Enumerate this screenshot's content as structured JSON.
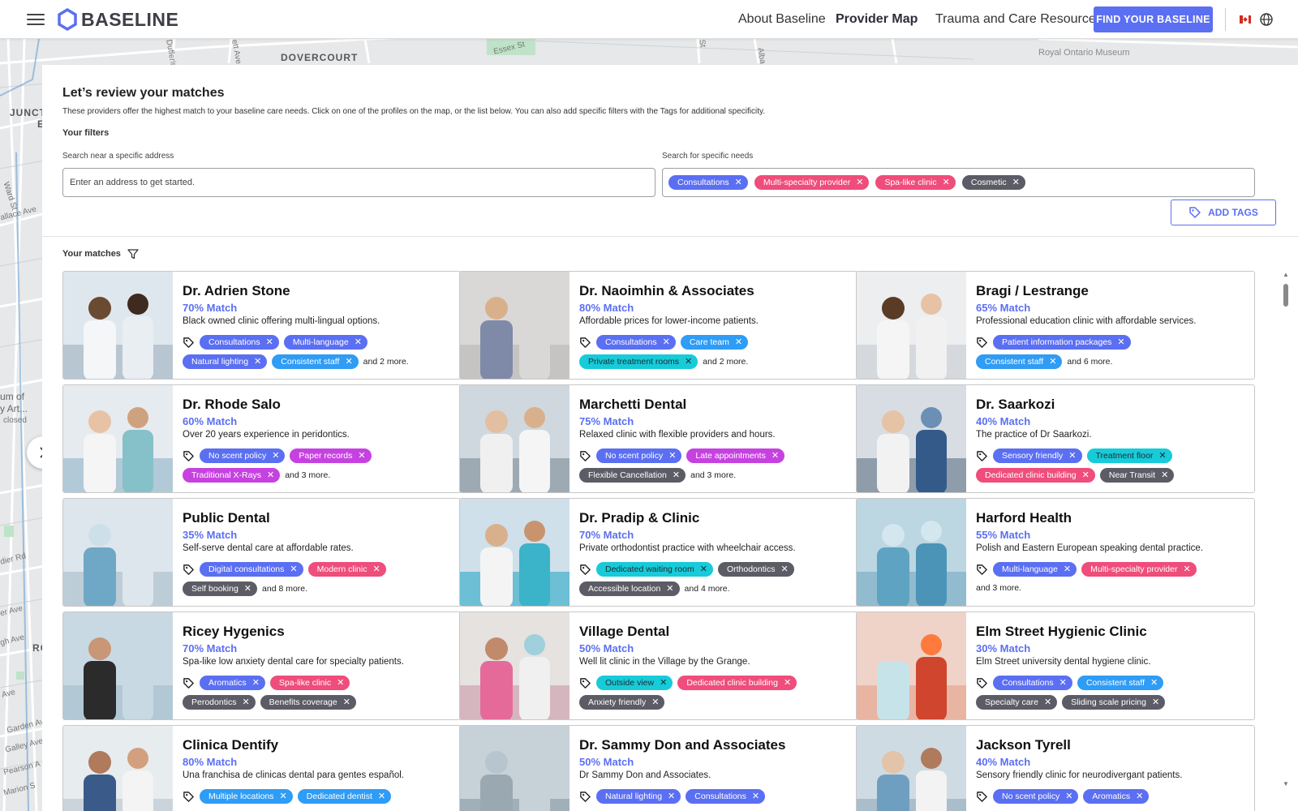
{
  "header": {
    "logo_text": "BASELINE",
    "nav": {
      "about": "About Baseline",
      "provider_map": "Provider Map",
      "resources": "Trauma and Care Resources"
    },
    "cta": "FIND YOUR BASELINE"
  },
  "map": {
    "labels": [
      "DOVERCOURT",
      "JUNCT",
      "E",
      "Ward St",
      "allace Ave",
      "um of",
      "y Art...",
      "closed",
      "dier Rd",
      "er Ave",
      "gh Ave",
      "RO",
      "Ave",
      "Garden Av",
      "Galley Ave",
      "Pearson A",
      "Marion S",
      "Dufferin",
      "ett Ave",
      "Essex St",
      "St",
      "Alba",
      "Royal Ontario Museum"
    ]
  },
  "panel": {
    "title": "Let’s review your matches",
    "description": "These providers offer the highest match to your baseline care needs. Click on one of the profiles on the map, or the list below. You can also add specific filters with the Tags for additional specificity.",
    "filters_label": "Your filters",
    "address_label": "Search near a specific address",
    "address_placeholder": "Enter an address to get started.",
    "needs_label": "Search for specific needs",
    "needs_tags": [
      {
        "label": "Consultations",
        "color": "#5b6ff2"
      },
      {
        "label": "Multi-specialty provider",
        "color": "#ef4d7b"
      },
      {
        "label": "Spa-like clinic",
        "color": "#ef4d7b"
      },
      {
        "label": "Cosmetic",
        "color": "#5c5c66"
      }
    ],
    "add_tags_label": "ADD TAGS",
    "matches_label": "Your matches"
  },
  "providers": [
    {
      "name": "Dr. Adrien Stone",
      "match": "70% Match",
      "desc": "Black owned clinic offering multi-lingual options.",
      "row1": [
        {
          "label": "Consultations",
          "c": "indigo"
        },
        {
          "label": "Multi-language",
          "c": "indigo"
        }
      ],
      "row2": [
        {
          "label": "Natural lighting",
          "c": "indigo"
        },
        {
          "label": "Consistent staff",
          "c": "blue"
        }
      ],
      "more": "and 2 more."
    },
    {
      "name": "Dr. Naoimhin & Associates",
      "match": "80% Match",
      "desc": "Affordable prices for lower-income patients.",
      "row1": [
        {
          "label": "Consultations",
          "c": "indigo"
        },
        {
          "label": "Care team",
          "c": "blue"
        }
      ],
      "row2": [
        {
          "label": "Private treatment rooms",
          "c": "cyan"
        }
      ],
      "more": "and 2 more."
    },
    {
      "name": "Bragi / Lestrange",
      "match": "65% Match",
      "desc": "Professional education clinic with affordable services.",
      "row1": [
        {
          "label": "Patient information packages",
          "c": "indigo"
        }
      ],
      "row2": [
        {
          "label": "Consistent staff",
          "c": "blue"
        }
      ],
      "more": "and 6 more."
    },
    {
      "name": "Dr. Rhode Salo",
      "match": "60% Match",
      "desc": "Over 20 years experience in peridontics.",
      "row1": [
        {
          "label": "No scent policy",
          "c": "indigo"
        },
        {
          "label": "Paper records",
          "c": "purple"
        }
      ],
      "row2": [
        {
          "label": "Traditional X-Rays",
          "c": "purple"
        }
      ],
      "more": "and 3 more."
    },
    {
      "name": "Marchetti Dental",
      "match": "75% Match",
      "desc": "Relaxed clinic with flexible providers and hours.",
      "row1": [
        {
          "label": "No scent policy",
          "c": "indigo"
        },
        {
          "label": "Late appointments",
          "c": "purple"
        }
      ],
      "row2": [
        {
          "label": "Flexible Cancellation",
          "c": "gray"
        }
      ],
      "more": "and 3 more."
    },
    {
      "name": "Dr. Saarkozi",
      "match": "40% Match",
      "desc": "The practice of Dr Saarkozi.",
      "row1": [
        {
          "label": "Sensory friendly",
          "c": "indigo"
        },
        {
          "label": "Treatment floor",
          "c": "cyan"
        }
      ],
      "row2": [
        {
          "label": "Dedicated clinic building",
          "c": "pink"
        },
        {
          "label": "Near Transit",
          "c": "gray"
        }
      ],
      "more": ""
    },
    {
      "name": "Public Dental",
      "match": "35% Match",
      "desc": "Self-serve dental care at affordable rates.",
      "row1": [
        {
          "label": "Digital consultations",
          "c": "indigo"
        },
        {
          "label": "Modern clinic",
          "c": "pink"
        }
      ],
      "row2": [
        {
          "label": "Self booking",
          "c": "gray"
        }
      ],
      "more": "and 8 more."
    },
    {
      "name": "Dr. Pradip & Clinic",
      "match": "70% Match",
      "desc": "Private orthodontist practice with wheelchair access.",
      "row1": [
        {
          "label": "Dedicated waiting room",
          "c": "cyan"
        },
        {
          "label": "Orthodontics",
          "c": "gray"
        }
      ],
      "row2": [
        {
          "label": "Accessible location",
          "c": "gray"
        }
      ],
      "more": "and 4 more."
    },
    {
      "name": "Harford Health",
      "match": "55% Match",
      "desc": "Polish and Eastern European speaking dental practice.",
      "row1": [
        {
          "label": "Multi-language",
          "c": "indigo"
        },
        {
          "label": "Multi-specialty provider",
          "c": "pink"
        }
      ],
      "row2": [],
      "more": "and 3 more."
    },
    {
      "name": "Ricey Hygenics",
      "match": "70% Match",
      "desc": "Spa-like low anxiety dental care for specialty patients.",
      "row1": [
        {
          "label": "Aromatics",
          "c": "indigo"
        },
        {
          "label": "Spa-like clinic",
          "c": "pink"
        }
      ],
      "row2": [
        {
          "label": "Perodontics",
          "c": "gray"
        },
        {
          "label": "Benefits coverage",
          "c": "gray"
        }
      ],
      "more": ""
    },
    {
      "name": "Village Dental",
      "match": "50% Match",
      "desc": "Well lit clinic in the Village by the Grange.",
      "row1": [
        {
          "label": "Outside view",
          "c": "cyan"
        },
        {
          "label": "Dedicated clinic building",
          "c": "pink"
        }
      ],
      "row2": [
        {
          "label": "Anxiety friendly",
          "c": "gray"
        }
      ],
      "more": ""
    },
    {
      "name": "Elm Street Hygienic Clinic",
      "match": "30% Match",
      "desc": "Elm Street university dental hygiene clinic.",
      "row1": [
        {
          "label": "Consultations",
          "c": "indigo"
        },
        {
          "label": "Consistent staff",
          "c": "blue"
        }
      ],
      "row2": [
        {
          "label": "Specialty care",
          "c": "gray"
        },
        {
          "label": "Sliding scale pricing",
          "c": "gray"
        }
      ],
      "more": ""
    },
    {
      "name": "Clinica Dentify",
      "match": "80% Match",
      "desc": "Una franchisa de clinicas dental para gentes español.",
      "row1": [
        {
          "label": "Multiple locations",
          "c": "blue"
        },
        {
          "label": "Dedicated dentist",
          "c": "blue"
        }
      ],
      "row2": [],
      "more": ""
    },
    {
      "name": "Dr. Sammy Don and Associates",
      "match": "50% Match",
      "desc": "Dr Sammy Don and Associates.",
      "row1": [
        {
          "label": "Natural lighting",
          "c": "indigo"
        },
        {
          "label": "Consultations",
          "c": "indigo"
        }
      ],
      "row2": [],
      "more": ""
    },
    {
      "name": "Jackson Tyrell",
      "match": "40% Match",
      "desc": "Sensory friendly clinic for neurodivergant patients.",
      "row1": [
        {
          "label": "No scent policy",
          "c": "indigo"
        },
        {
          "label": "Aromatics",
          "c": "indigo"
        }
      ],
      "row2": [],
      "more": ""
    }
  ],
  "icons": {
    "menu": "hamburger-icon",
    "logo": "hexagon-logo-icon",
    "flag": "canada-flag-icon",
    "globe": "globe-icon",
    "tag": "tag-icon",
    "filter": "filter-icon",
    "close": "close-icon",
    "chevron": "chevron-right-icon"
  },
  "colors": {
    "accent": "#5b6ff2",
    "pink": "#ef4d7b",
    "purple": "#c642e0",
    "gray": "#5c5c66",
    "cyan": "#17cbd9",
    "blue": "#2f9cf5"
  }
}
